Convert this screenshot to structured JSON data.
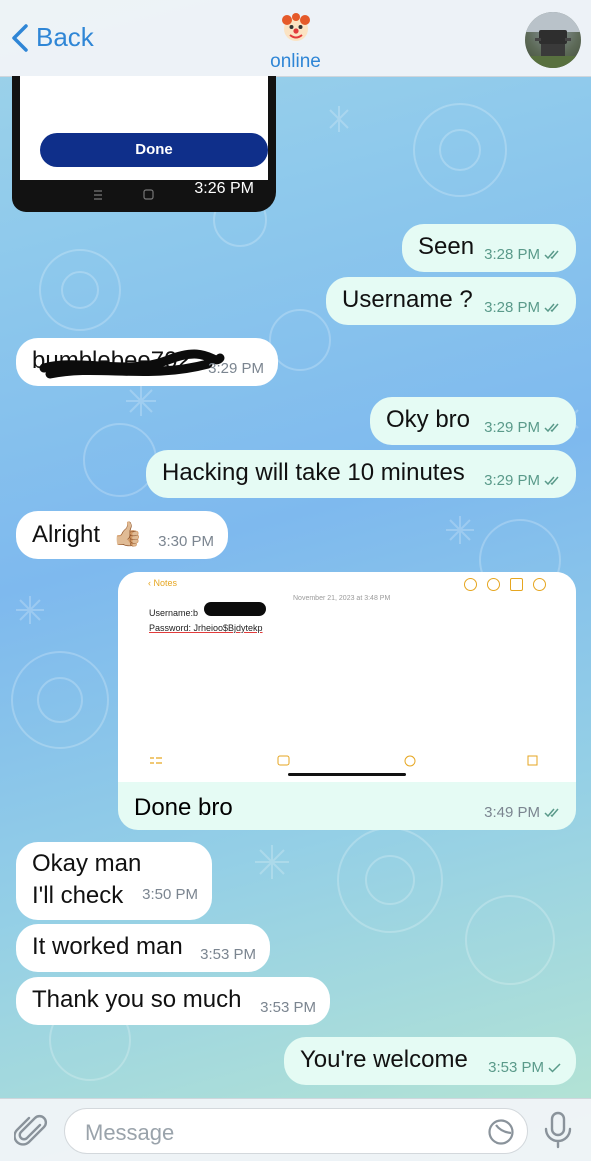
{
  "header": {
    "back_label": "Back",
    "status": "online"
  },
  "messages": [
    {
      "text": "Seen",
      "time": "3:28 PM",
      "read": true
    },
    {
      "text": "Username ?",
      "time": "3:28 PM",
      "read": true
    },
    {
      "text": "bumblebee702",
      "time": "3:29 PM"
    },
    {
      "text": "Oky bro",
      "time": "3:29 PM",
      "read": true
    },
    {
      "text": "Hacking will take 10 minutes",
      "time": "3:29 PM",
      "read": true
    },
    {
      "text": "Alright",
      "emoji": "👍🏼",
      "time": "3:30 PM"
    },
    {
      "text": "Done bro",
      "time": "3:49 PM",
      "read": true
    },
    {
      "text_lines": [
        "Okay man",
        "I'll check"
      ],
      "time": "3:50 PM"
    },
    {
      "text": "It worked man",
      "time": "3:53 PM"
    },
    {
      "text": "Thank you so much",
      "time": "3:53 PM"
    },
    {
      "text": "You're welcome",
      "time": "3:53 PM",
      "read": false
    }
  ],
  "screenshot_bubble": {
    "button_label": "Done",
    "time": "3:26 PM"
  },
  "notes_image": {
    "back_label": "Notes",
    "date": "November 21, 2023 at 3:48 PM",
    "username_label": "Username:b",
    "password_label": "Password: Jrheioo$Bjdytekp"
  },
  "input": {
    "placeholder": "Message"
  },
  "colors": {
    "accent": "#2f86d6",
    "outgoing_bubble": "#e5fbf4",
    "incoming_bubble": "#ffffff",
    "notes_accent": "#e6a620"
  }
}
